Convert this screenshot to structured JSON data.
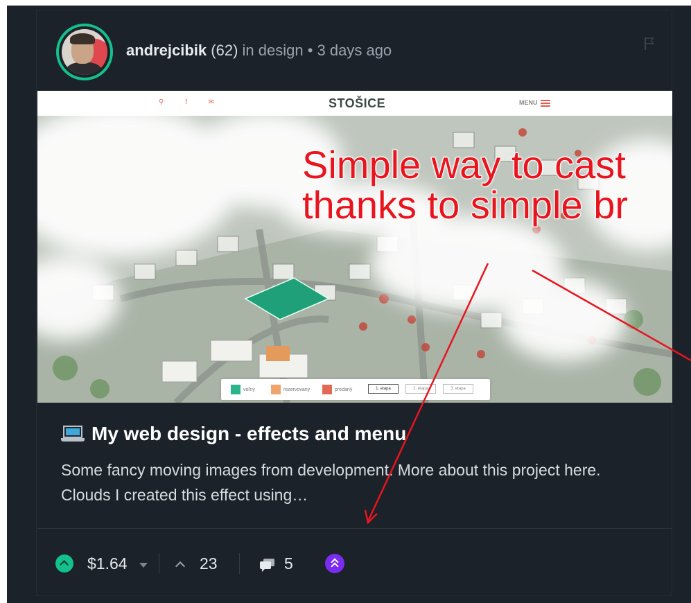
{
  "post": {
    "author": "andrejcibik",
    "reputation": "(62)",
    "community_text": "in design • 3 days ago",
    "title": "My web design - effects and menu",
    "description": "Some fancy moving images from development. More about this project here.   Clouds I created this effect using…"
  },
  "hero": {
    "site_logo": "STOŠICE",
    "menu_label": "MENU",
    "overlay_line1": "Simple way to cast",
    "overlay_line2": "thanks to simple br",
    "legend": [
      {
        "label": "voľný",
        "color": "#2bb58a"
      },
      {
        "label": "rezervovaný",
        "color": "#f0a46a"
      },
      {
        "label": "predaný",
        "color": "#e06a55"
      }
    ],
    "stages": [
      "1. etapa",
      "2. etapa",
      "3. etapa"
    ]
  },
  "footer": {
    "payout": "$1.64",
    "votes": "23",
    "comments": "5"
  },
  "icons": [
    "flag-icon",
    "laptop-icon",
    "upvote-icon",
    "caret-down-icon",
    "chevron-up-icon",
    "comment-icon",
    "boost-icon"
  ],
  "colors": {
    "background": "#1c2229",
    "accent_green": "#14c08c",
    "boost_purple": "#7a2cf0",
    "annotation_red": "#e8141e"
  }
}
